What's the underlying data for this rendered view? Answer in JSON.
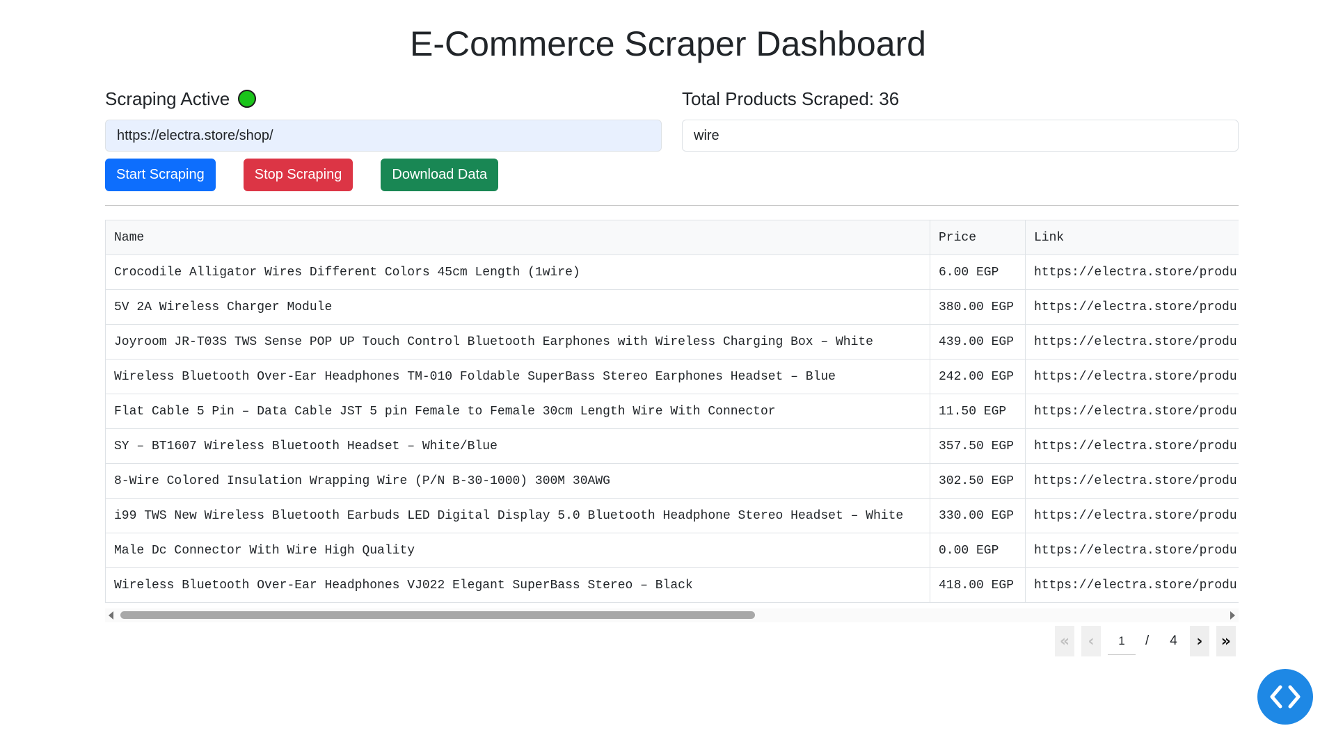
{
  "header": {
    "title": "E-Commerce Scraper Dashboard"
  },
  "status": {
    "label": "Scraping Active",
    "indicator_color": "#1bc41b",
    "total_label": "Total Products Scraped: 36"
  },
  "inputs": {
    "url_value": "https://electra.store/shop/",
    "keyword_value": "wire"
  },
  "buttons": {
    "start": "Start Scraping",
    "stop": "Stop Scraping",
    "download": "Download Data"
  },
  "table": {
    "headers": {
      "name": "Name",
      "price": "Price",
      "link": "Link"
    },
    "rows": [
      {
        "name": "Crocodile Alligator Wires Different Colors 45cm Length (1wire)",
        "price": "6.00 EGP",
        "link": "https://electra.store/produ"
      },
      {
        "name": "5V 2A Wireless Charger Module",
        "price": "380.00 EGP",
        "link": "https://electra.store/produ"
      },
      {
        "name": "Joyroom JR-T03S TWS Sense POP UP Touch Control Bluetooth Earphones with Wireless Charging Box – White",
        "price": "439.00 EGP",
        "link": "https://electra.store/produ"
      },
      {
        "name": "Wireless Bluetooth Over-Ear Headphones TM-010 Foldable SuperBass Stereo Earphones Headset – Blue",
        "price": "242.00 EGP",
        "link": "https://electra.store/produ"
      },
      {
        "name": "Flat Cable 5 Pin – Data Cable JST 5 pin Female to Female 30cm Length Wire With Connector",
        "price": "11.50 EGP",
        "link": "https://electra.store/produ"
      },
      {
        "name": "SY – BT1607 Wireless Bluetooth Headset – White/Blue",
        "price": "357.50 EGP",
        "link": "https://electra.store/produ"
      },
      {
        "name": "8-Wire Colored Insulation Wrapping Wire (P/N B-30-1000) 300M 30AWG",
        "price": "302.50 EGP",
        "link": "https://electra.store/produ"
      },
      {
        "name": "i99 TWS New Wireless Bluetooth Earbuds LED Digital Display 5.0 Bluetooth Headphone Stereo Headset – White",
        "price": "330.00 EGP",
        "link": "https://electra.store/produ"
      },
      {
        "name": "Male Dc Connector With Wire High Quality",
        "price": "0.00 EGP",
        "link": "https://electra.store/produ"
      },
      {
        "name": "Wireless Bluetooth Over-Ear Headphones VJ022 Elegant SuperBass Stereo – Black",
        "price": "418.00 EGP",
        "link": "https://electra.store/produ"
      }
    ]
  },
  "pagination": {
    "current_page": "1",
    "separator": "/",
    "total_pages": "4",
    "first_icon": "double-chevron-left-icon",
    "prev_icon": "chevron-left-icon",
    "next_icon": "chevron-right-icon",
    "last_icon": "double-chevron-right-icon"
  },
  "fab": {
    "icon": "code-icon",
    "color": "#1e88e5"
  },
  "colors": {
    "start_button": "#0d6efd",
    "stop_button": "#dc3545",
    "download_button": "#198754"
  }
}
